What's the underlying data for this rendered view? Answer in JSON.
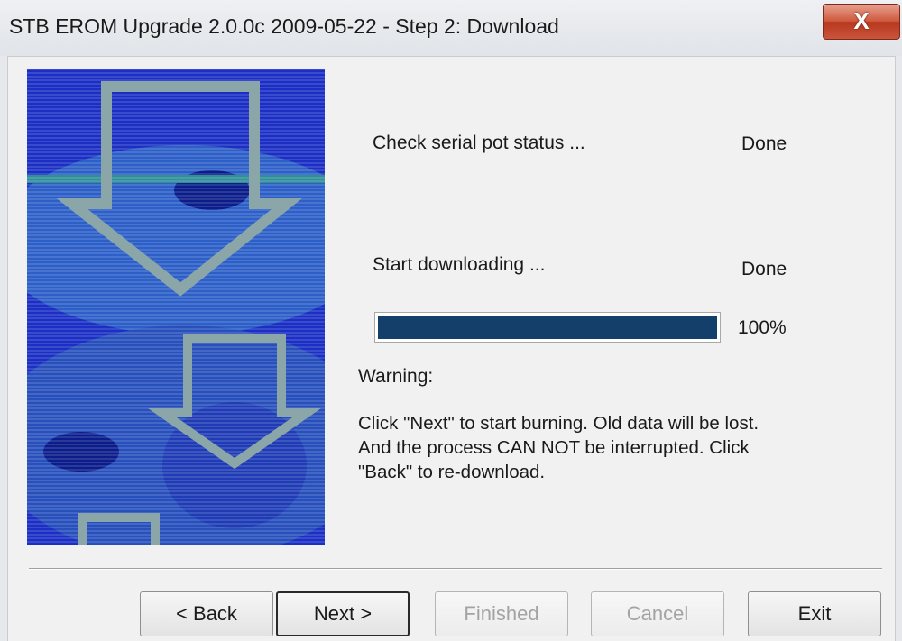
{
  "window": {
    "title": "STB EROM Upgrade 2.0.0c 2009-05-22 - Step 2: Download",
    "close_glyph": "X"
  },
  "status": {
    "check_serial_label": "Check serial pot status ...",
    "check_serial_status": "Done",
    "download_label": "Start downloading ...",
    "download_status": "Done",
    "progress_fraction": 1.0,
    "progress_text": "100%"
  },
  "warning": {
    "heading": "Warning:",
    "message": "Click \"Next\" to start burning. Old data will be lost. And the process CAN NOT be interrupted. Click \"Back\" to re-download."
  },
  "buttons": {
    "back": "< Back",
    "next": "Next >",
    "finished": "Finished",
    "cancel": "Cancel",
    "exit": "Exit"
  },
  "colors": {
    "progress_fill": "#153f6b",
    "banner_blue": "#1c2fc4",
    "arrow_gray": "#8aa6a8"
  }
}
